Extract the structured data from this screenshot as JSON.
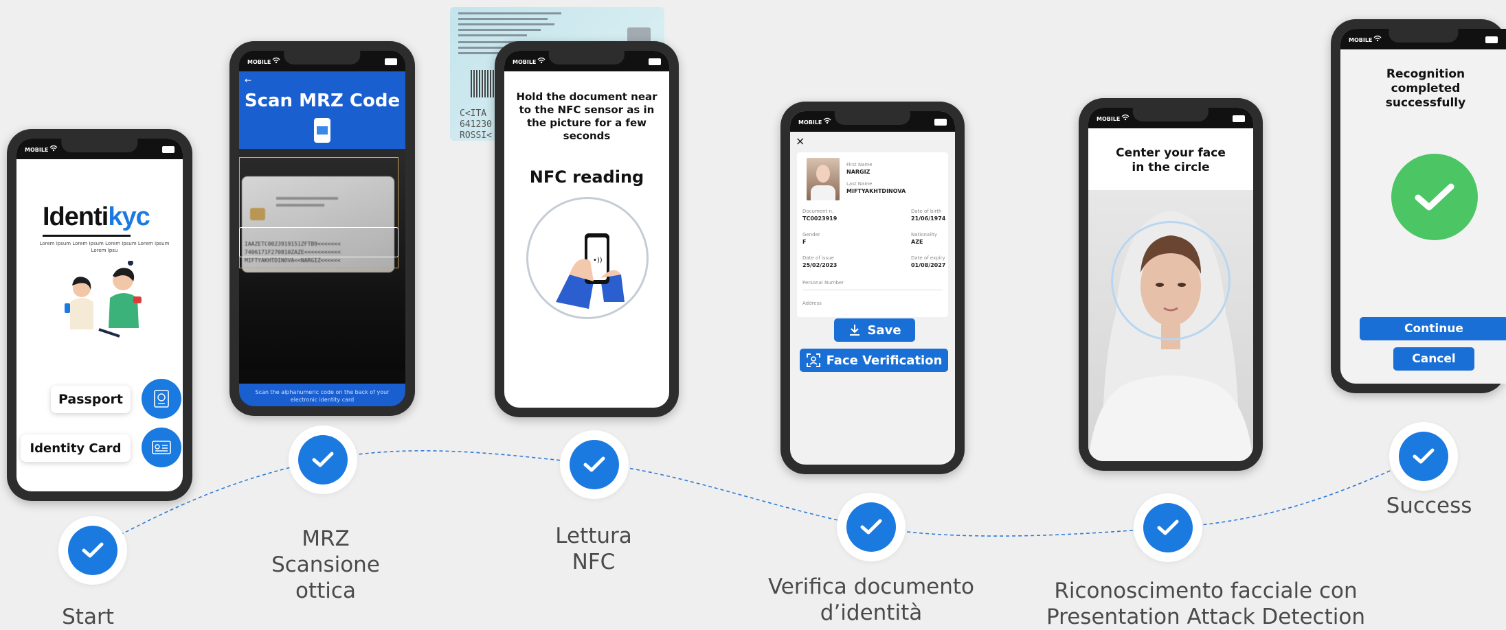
{
  "steps": [
    {
      "label_lines": [
        "Start"
      ]
    },
    {
      "label_lines": [
        "MRZ",
        "Scansione",
        "ottica"
      ]
    },
    {
      "label_lines": [
        "Lettura",
        "NFC"
      ]
    },
    {
      "label_lines": [
        "Verifica documento",
        "d’identità"
      ]
    },
    {
      "label_lines": [
        "Riconoscimento facciale con",
        "Presentation Attack Detection"
      ]
    },
    {
      "label_lines": [
        "Success"
      ]
    }
  ],
  "status_bar": {
    "carrier": "MOBILE"
  },
  "colors": {
    "accent": "#1a6fd6",
    "check": "#1a7ae0",
    "success": "#4cc565",
    "background": "#efefef"
  },
  "screen_start": {
    "logo_text_black": "Iden",
    "logo_text_black2": "ti",
    "logo_text_blue": "kyc",
    "tagline": "Lorem Ipsum Lorem Ipsum Lorem Ipsum Lorem Ipsum Lorem Ipsu",
    "passport_label": "Passport",
    "identity_card_label": "Identity Card"
  },
  "screen_mrz": {
    "title": "Scan MRZ Code",
    "footer_text": "Scan the alphanumeric code on the back of your electronic identity card",
    "mrz_line1": "IAAZETC0023919151ZFTB9<<<<<<<",
    "mrz_line2": "7406171F270810ZAZE<<<<<<<<<<<",
    "mrz_line3": "MIFTYAKHTDINOVA<<NARGIZ<<<<<<"
  },
  "id_card_preview": {
    "mrz_line1": "C<ITA",
    "mrz_line2": "641230",
    "mrz_line3": "ROSSI<"
  },
  "screen_nfc": {
    "instruction": "Hold the document near to the NFC sensor as in the picture for a few seconds",
    "title": "NFC reading"
  },
  "screen_verify": {
    "close_icon": "×",
    "first_name_label": "First Name",
    "first_name": "NARGIZ",
    "last_name_label": "Last Name",
    "last_name": "MIFTYAKHTDINOVA",
    "fields": [
      {
        "label": "Document n.",
        "value": "TC0023919"
      },
      {
        "label": "Date of birth",
        "value": "21/06/1974"
      },
      {
        "label": "Gender",
        "value": "F"
      },
      {
        "label": "Nationality",
        "value": "AZE"
      },
      {
        "label": "Date of issue",
        "value": "25/02/2023"
      },
      {
        "label": "Date of expiry",
        "value": "01/08/2027"
      },
      {
        "label": "Personal Number",
        "value": ""
      },
      {
        "label": "Address",
        "value": ""
      }
    ],
    "save_label": "Save",
    "face_verification_label": "Face Verification"
  },
  "screen_face": {
    "instruction": "Center your face in the circle"
  },
  "screen_success": {
    "title": "Recognition completed successfully",
    "continue_label": "Continue",
    "cancel_label": "Cancel"
  }
}
